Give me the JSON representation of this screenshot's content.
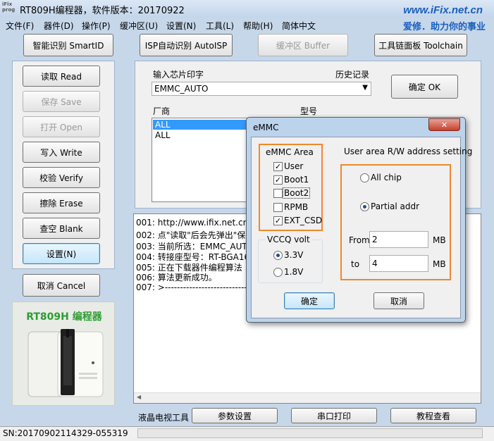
{
  "window": {
    "title": "RT809H编程器，软件版本：20170922",
    "app_icon_text": "iFix prog",
    "brand_url": "www.iFix.net.cn",
    "brand_slogan": "爱修．助力你的事业"
  },
  "menu": [
    "文件(F)",
    "器件(D)",
    "操作(P)",
    "缓冲区(U)",
    "设置(N)",
    "工具(L)",
    "帮助(H)",
    "简体中文"
  ],
  "top_buttons": {
    "smart_id": "智能识别 SmartID",
    "isp_auto": "ISP自动识别 AutoISP",
    "buffer": "缓冲区 Buffer",
    "toolchain": "工具链面板 Toolchain"
  },
  "side_buttons": {
    "read": "读取 Read",
    "save": "保存 Save",
    "open": "打开 Open",
    "write": "写入 Write",
    "verify": "校验 Verify",
    "erase": "擦除 Erase",
    "blank": "查空 Blank",
    "settings": "设置(N)",
    "cancel": "取消 Cancel"
  },
  "product_banner": "RT809H 编程器",
  "chip_input": {
    "label": "输入芯片印字",
    "history_label": "历史记录",
    "value": "EMMC_AUTO",
    "ok": "确定 OK"
  },
  "vendor_list": {
    "vendor_label": "厂商",
    "model_label": "型号",
    "items": [
      "ALL",
      "ALL"
    ]
  },
  "log": [
    "001:  http://www.ifix.net.cn/thr",
    "002:  点\"读取\"后会先弹出\"保存",
    "003:  当前所选：EMMC_AUT",
    "004:  转接座型号：RT-BGA16",
    "005:  正在下载器件编程算法 .",
    "006:  算法更新成功。",
    "007:  >----------------------------"
  ],
  "bottom_bar": {
    "lcd_tool": "液晶电视工具",
    "params": "参数设置",
    "serial": "串口打印",
    "tutorial": "教程查看"
  },
  "status": {
    "sn": "SN:20170902114329-055319"
  },
  "dialog": {
    "title": "eMMC",
    "close": "✕",
    "emmc_area": {
      "title": "eMMC Area",
      "items": [
        {
          "label": "User",
          "checked": true
        },
        {
          "label": "Boot1",
          "checked": true
        },
        {
          "label": "Boot2",
          "checked": false
        },
        {
          "label": "RPMB",
          "checked": false
        },
        {
          "label": "EXT_CSD",
          "checked": true
        }
      ]
    },
    "vccq": {
      "title": "VCCQ volt",
      "options": [
        {
          "label": "3.3V",
          "selected": true
        },
        {
          "label": "1.8V",
          "selected": false
        }
      ]
    },
    "user_area": {
      "title": "User area R/W address setting",
      "all_chip": "All chip",
      "partial": "Partial addr",
      "from_label": "From",
      "from_value": "2",
      "to_label": "to",
      "to_value": "4",
      "unit": "MB"
    },
    "ok": "确定",
    "cancel": "取消"
  },
  "colors": {
    "accent_orange": "#f0882a",
    "brand_blue": "#1a5fc0",
    "selection_blue": "#3399ff"
  }
}
